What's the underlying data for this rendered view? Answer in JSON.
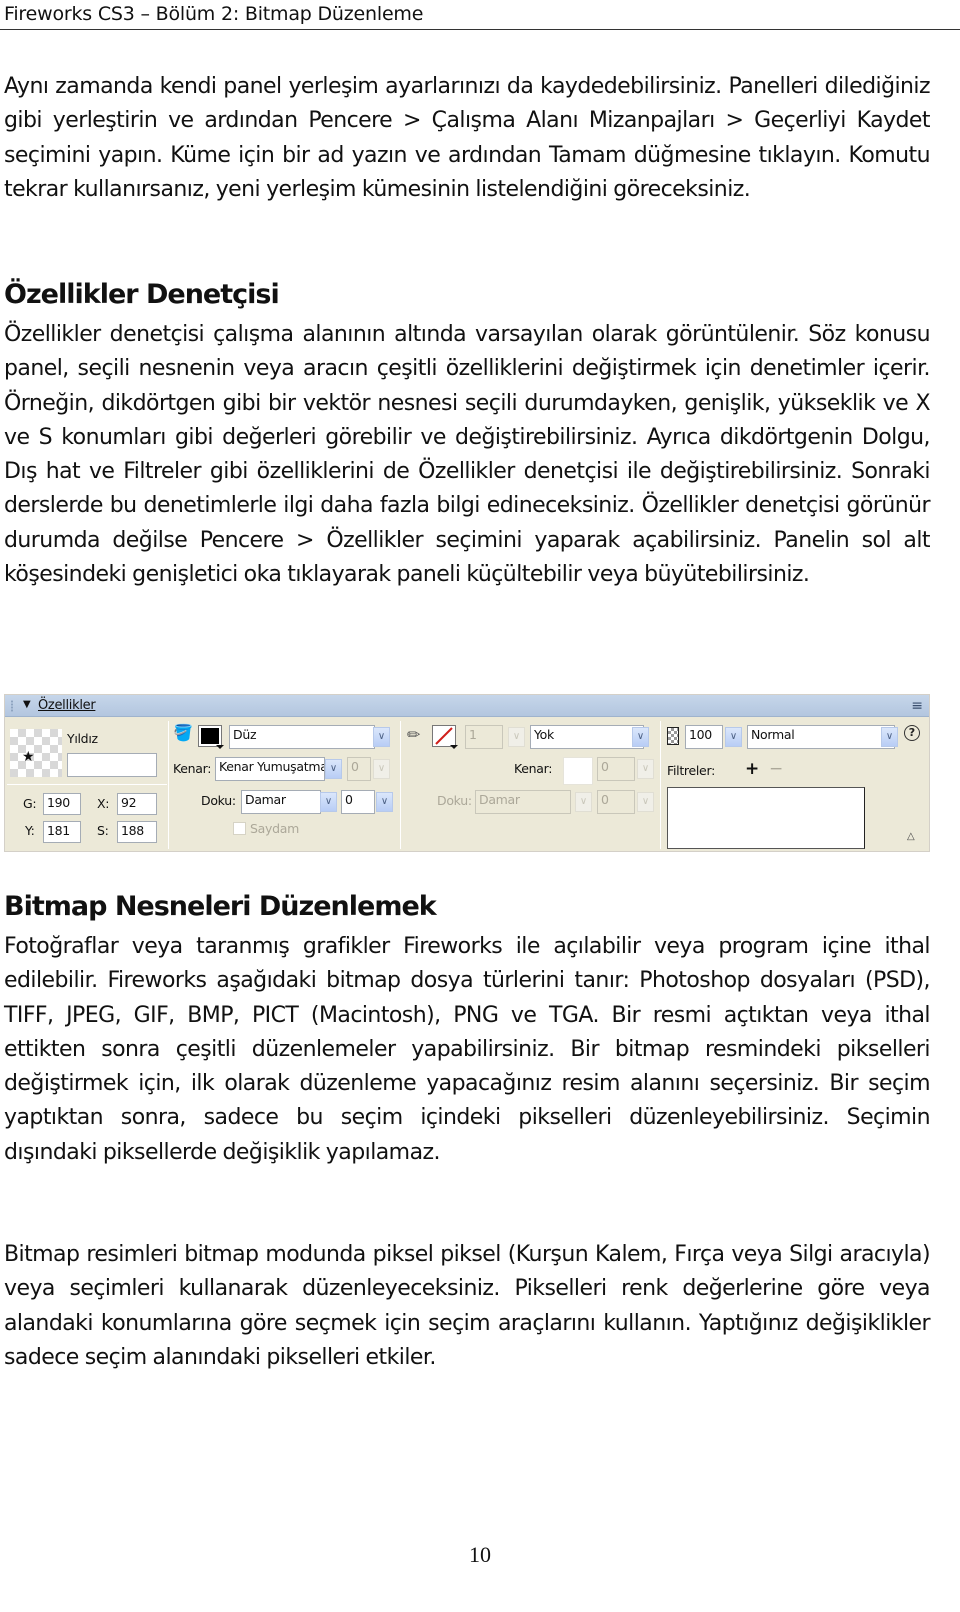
{
  "header": {
    "running_title": "Fireworks CS3 – Bölüm 2: Bitmap Düzenleme"
  },
  "paragraphs": {
    "p1": "Aynı zamanda kendi panel yerleşim ayarlarınızı da kaydedebilirsiniz. Panelleri dilediğiniz gibi yerleştirin ve ardından Pencere > Çalışma Alanı Mizanpajları > Geçerliyi Kaydet seçimini yapın. Küme için bir ad yazın ve ardından Tamam düğmesine tıklayın. Komutu tekrar kullanırsanız, yeni yerleşim kümesinin listelendiğini göreceksiniz.",
    "h1": "Özellikler Denetçisi",
    "p2": "Özellikler denetçisi çalışma alanının altında varsayılan olarak görüntülenir. Söz konusu panel, seçili nesnenin veya aracın çeşitli özelliklerini değiştirmek için denetimler içerir. Örneğin, dikdörtgen gibi bir vektör nesnesi seçili durumdayken, genişlik, yükseklik ve X ve S konumları gibi değerleri görebilir ve değiştirebilirsiniz. Ayrıca dikdörtgenin Dolgu, Dış hat ve Filtreler gibi özelliklerini de Özellikler denetçisi ile değiştirebilirsiniz. Sonraki derslerde bu denetimlerle ilgi daha fazla bilgi edineceksiniz. Özellikler denetçisi görünür durumda değilse Pencere > Özellikler seçimini yaparak açabilirsiniz. Panelin sol alt köşesindeki genişletici oka tıklayarak paneli küçültebilir veya büyütebilirsiniz.",
    "h2": "Bitmap Nesneleri Düzenlemek",
    "p3": "Fotoğraflar veya taranmış grafikler Fireworks ile açılabilir veya program içine ithal edilebilir. Fireworks aşağıdaki bitmap dosya türlerini tanır: Photoshop dosyaları (PSD), TIFF, JPEG, GIF, BMP, PICT (Macintosh), PNG ve TGA. Bir resmi açtıktan veya ithal ettikten sonra çeşitli düzenlemeler yapabilirsiniz. Bir bitmap resmindeki pikselleri değiştirmek için, ilk olarak düzenleme yapacağınız resim alanını seçersiniz. Bir seçim yaptıktan sonra, sadece bu seçim içindeki pikselleri düzenleyebilirsiniz. Seçimin dışındaki piksellerde değişiklik yapılamaz.",
    "p4": "Bitmap resimleri bitmap modunda piksel piksel (Kurşun Kalem, Fırça veya Silgi aracıyla) veya seçimleri kullanarak düzenleyeceksiniz. Pikselleri renk değerlerine göre veya alandaki konumlarına göre seçmek için seçim araçlarını kullanın. Yaptığınız değişiklikler sadece seçim alanındaki pikselleri etkiler."
  },
  "properties_panel": {
    "title": "Özellikler",
    "collapse_icon": "▼",
    "options_icon": "≡",
    "object": {
      "type_label": "Yıldız",
      "name_value": "",
      "thumbnail_icon": "★"
    },
    "geometry": {
      "w_label": "G:",
      "w_value": "190",
      "x_label": "X:",
      "x_value": "92",
      "h_label": "Y:",
      "h_value": "181",
      "y_label": "S:",
      "y_value": "188"
    },
    "fill": {
      "icon": "paint-bucket",
      "color": "#000000",
      "type_value": "Düz",
      "edge_label": "Kenar:",
      "edge_value": "Kenar Yumuşatma",
      "edge_amount": "0",
      "texture_label": "Doku:",
      "texture_value": "Damar",
      "texture_amount": "0",
      "transparent_label": "Saydam",
      "transparent_checked": false
    },
    "stroke": {
      "icon": "pencil",
      "color": "none",
      "size_value": "1",
      "type_value": "Yok",
      "edge_label": "Kenar:",
      "edge_value": "",
      "edge_amount": "0",
      "texture_label": "Doku:",
      "texture_value": "Damar",
      "texture_amount": "0"
    },
    "effects": {
      "opacity_value": "100",
      "blend_mode_value": "Normal",
      "filters_label": "Filtreler:",
      "add_icon": "+",
      "remove_icon": "−",
      "help_icon": "?",
      "expander_icon": "△"
    }
  },
  "footer": {
    "page_number": "10"
  }
}
